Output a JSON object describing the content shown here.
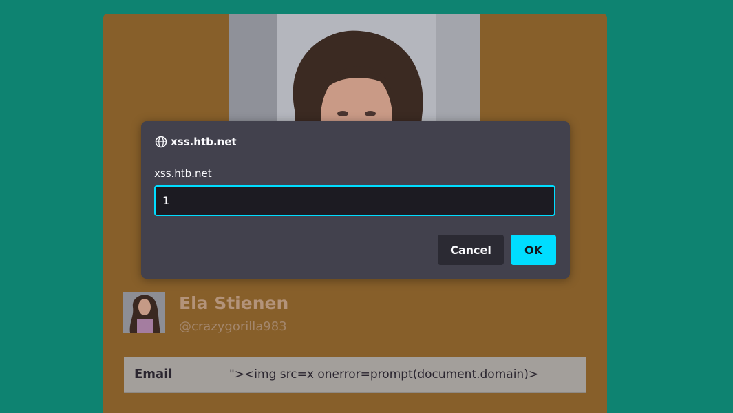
{
  "profile": {
    "name": "Ela Stienen",
    "handle": "@crazygorilla983"
  },
  "info": [
    {
      "label": "Email",
      "value": "\"><img src=x onerror=prompt(document.domain)>"
    }
  ],
  "dialog": {
    "title": "xss.htb.net",
    "message": "xss.htb.net",
    "input_value": "1",
    "cancel_label": "Cancel",
    "ok_label": "OK"
  },
  "colors": {
    "background": "#0e8371",
    "card": "#875f2a",
    "dialog": "#42414d",
    "accent": "#00ddff"
  },
  "icons": {
    "dialog_icon": "globe-icon"
  }
}
